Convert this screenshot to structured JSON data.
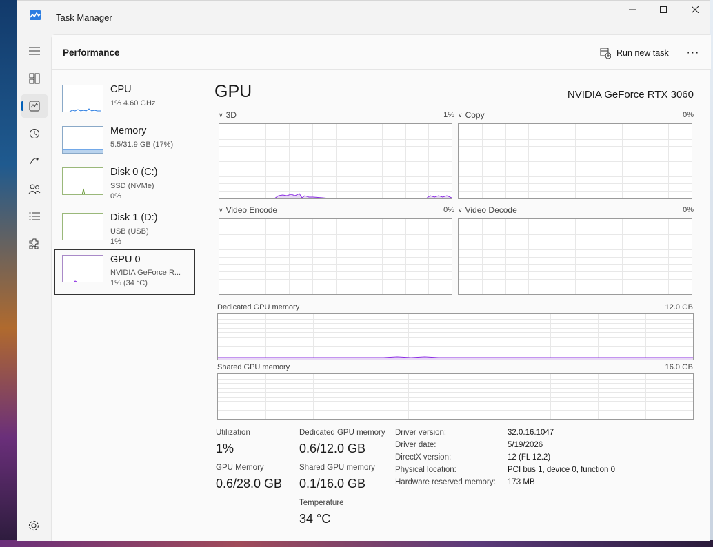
{
  "window": {
    "title": "Task Manager"
  },
  "header": {
    "title": "Performance",
    "run_new_task": "Run new task",
    "more": "···"
  },
  "nav": {
    "items": [
      {
        "name": "hamburger-menu-icon"
      },
      {
        "name": "processes-icon"
      },
      {
        "name": "performance-icon"
      },
      {
        "name": "app-history-icon"
      },
      {
        "name": "startup-apps-icon"
      },
      {
        "name": "users-icon"
      },
      {
        "name": "details-icon"
      },
      {
        "name": "services-icon"
      }
    ]
  },
  "devices": [
    {
      "name": "CPU",
      "sub1": "1% 4.60 GHz",
      "sub2": ""
    },
    {
      "name": "Memory",
      "sub1": "5.5/31.9 GB (17%)",
      "sub2": ""
    },
    {
      "name": "Disk 0 (C:)",
      "sub1": "SSD (NVMe)",
      "sub2": "0%"
    },
    {
      "name": "Disk 1 (D:)",
      "sub1": "USB (USB)",
      "sub2": "1%"
    },
    {
      "name": "GPU 0",
      "sub1": "NVIDIA GeForce R...",
      "sub2": "1% (34 °C)"
    }
  ],
  "gpu": {
    "title": "GPU",
    "model": "NVIDIA GeForce RTX 3060",
    "engines": [
      {
        "label": "3D",
        "value": "1%"
      },
      {
        "label": "Copy",
        "value": "0%"
      },
      {
        "label": "Video Encode",
        "value": "0%"
      },
      {
        "label": "Video Decode",
        "value": "0%"
      }
    ],
    "dedicated_mem": {
      "label": "Dedicated GPU memory",
      "max": "12.0 GB"
    },
    "shared_mem": {
      "label": "Shared GPU memory",
      "max": "16.0 GB"
    }
  },
  "stats": {
    "utilization": {
      "label": "Utilization",
      "value": "1%"
    },
    "gpu_memory": {
      "label": "GPU Memory",
      "value": "0.6/28.0 GB"
    },
    "dedicated": {
      "label": "Dedicated GPU memory",
      "value": "0.6/12.0 GB"
    },
    "shared": {
      "label": "Shared GPU memory",
      "value": "0.1/16.0 GB"
    },
    "temperature": {
      "label": "Temperature",
      "value": "34 °C"
    }
  },
  "info": [
    {
      "key": "Driver version:",
      "value": "32.0.16.1047"
    },
    {
      "key": "Driver date:",
      "value": "5/19/2026"
    },
    {
      "key": "DirectX version:",
      "value": "12 (FL 12.2)"
    },
    {
      "key": "Physical location:",
      "value": "PCI bus 1, device 0, function 0"
    },
    {
      "key": "Hardware reserved memory:",
      "value": "173 MB"
    }
  ],
  "colors": {
    "accent": "#005fb8",
    "gpu_line": "#8a2be2",
    "grid": "#e8e8e8"
  }
}
